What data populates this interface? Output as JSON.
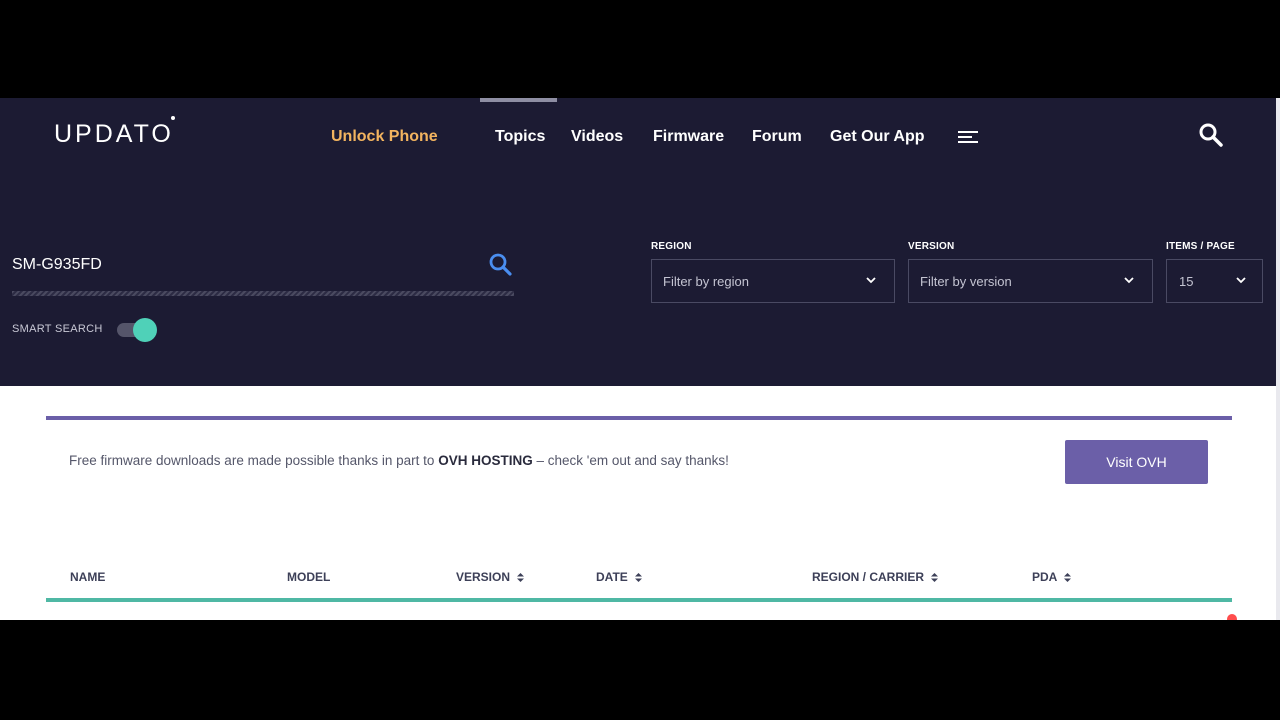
{
  "logo": {
    "text": "UPDATO"
  },
  "nav": {
    "items": [
      {
        "label": "Unlock Phone",
        "highlight": true
      },
      {
        "label": "Topics"
      },
      {
        "label": "Videos"
      },
      {
        "label": "Firmware"
      },
      {
        "label": "Forum"
      },
      {
        "label": "Get Our App"
      }
    ]
  },
  "search": {
    "value": "SM-G935FD"
  },
  "smart_search": {
    "label": "SMART SEARCH",
    "enabled": true
  },
  "filters": {
    "region": {
      "label": "REGION",
      "placeholder": "Filter by region"
    },
    "version": {
      "label": "VERSION",
      "placeholder": "Filter by version"
    },
    "items_per_page": {
      "label": "ITEMS / PAGE",
      "value": "15"
    }
  },
  "promo": {
    "text_before": "Free firmware downloads are made possible thanks in part to",
    "brand": "OVH HOSTING",
    "text_after": "– check 'em out and say thanks!",
    "button_label": "Visit OVH"
  },
  "table": {
    "headers": [
      {
        "label": "NAME",
        "sortable": false
      },
      {
        "label": "MODEL",
        "sortable": false
      },
      {
        "label": "VERSION",
        "sortable": true
      },
      {
        "label": "DATE",
        "sortable": true
      },
      {
        "label": "REGION / CARRIER",
        "sortable": true
      },
      {
        "label": "PDA",
        "sortable": true
      }
    ]
  },
  "colors": {
    "header_bg": "#1c1b33",
    "accent_orange": "#f3b45f",
    "accent_purple": "#6b5fa8",
    "accent_teal": "#4fb8a4",
    "search_blue": "#4a8ef0"
  }
}
